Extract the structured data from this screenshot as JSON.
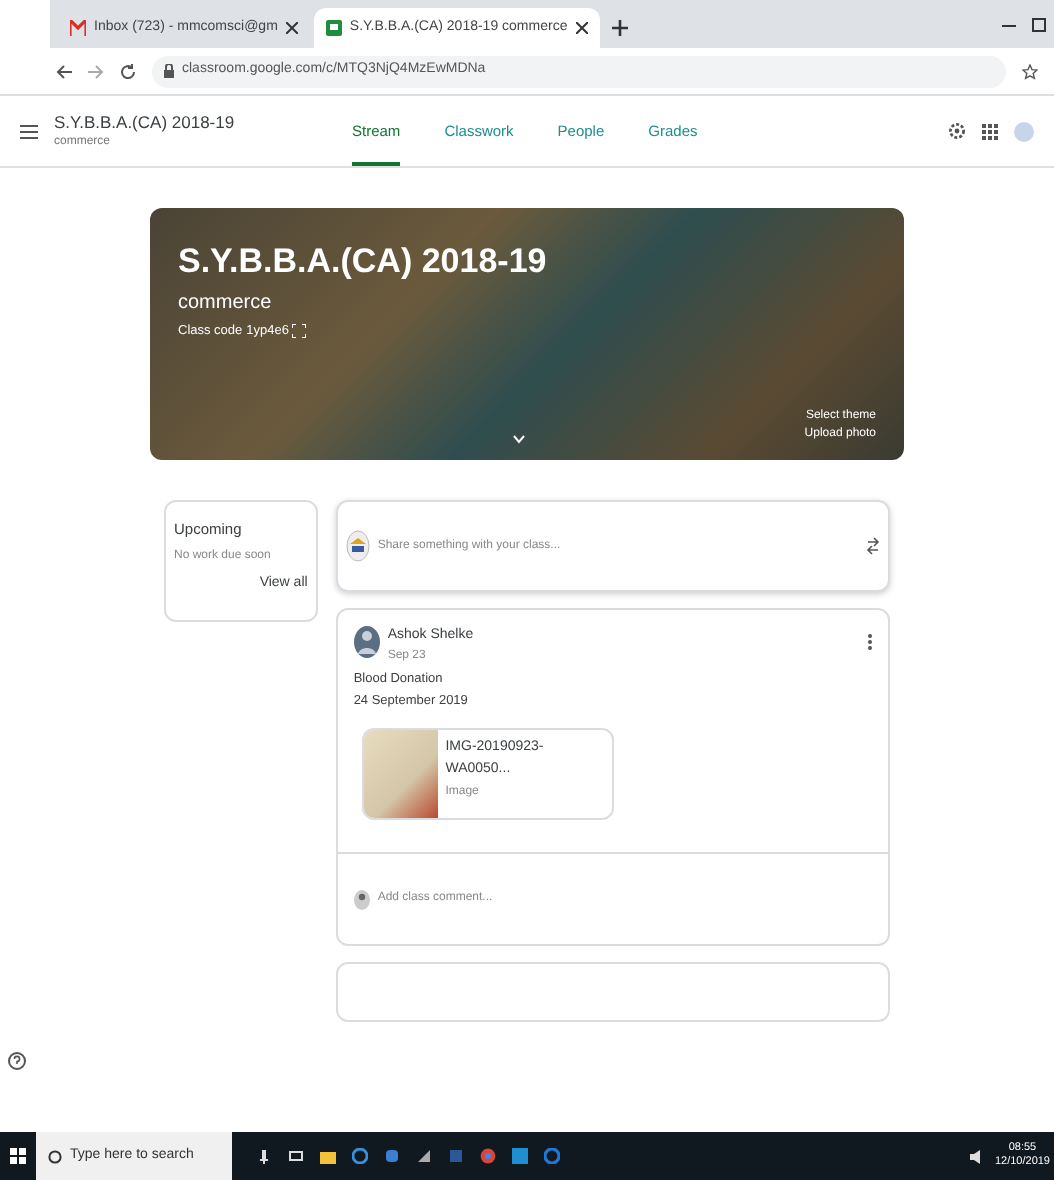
{
  "browser": {
    "tabs": [
      {
        "title": "Inbox (723) - mmcomsci@gm",
        "selected": false
      },
      {
        "title": "S.Y.B.B.A.(CA) 2018-19 commerce",
        "selected": true
      }
    ],
    "url": "classroom.google.com/c/MTQ3NjQ4MzEwMDNa"
  },
  "header": {
    "class_name": "S.Y.B.B.A.(CA) 2018-19",
    "section": "commerce",
    "tabs": [
      {
        "label": "Stream",
        "selected": true
      },
      {
        "label": "Classwork",
        "selected": false
      },
      {
        "label": "People",
        "selected": false
      },
      {
        "label": "Grades",
        "selected": false
      }
    ]
  },
  "banner": {
    "title": "S.Y.B.B.A.(CA) 2018-19",
    "section": "commerce",
    "class_code_label": "Class code",
    "class_code": "1yp4e6",
    "select_theme": "Select theme",
    "upload_photo": "Upload photo"
  },
  "upcoming": {
    "title": "Upcoming",
    "message": "No work due soon",
    "link": "View all"
  },
  "share": {
    "placeholder": "Share something with your class..."
  },
  "post": {
    "author": "Ashok Shelke",
    "date": "Sep 23",
    "lines": [
      "Blood Donation",
      "24 September 2019"
    ],
    "attachment": {
      "name": "IMG-20190923-WA0050...",
      "type": "Image"
    },
    "comment_placeholder": "Add class comment..."
  },
  "taskbar": {
    "search_placeholder": "Type here to search",
    "time": "08:55",
    "date": "12/10/2019"
  }
}
